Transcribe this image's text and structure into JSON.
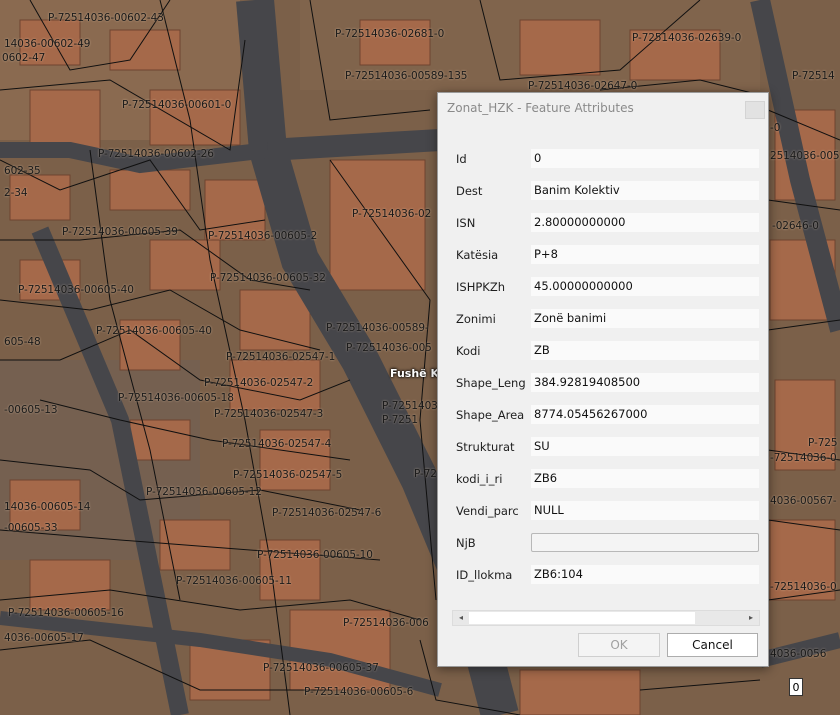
{
  "map": {
    "parcel_labels": [
      "P-72514036-00602-43",
      "14036-00602-49",
      "0602-47",
      "P-72514036-02681-0",
      "P-72514036-02639-0",
      "P-72514036-00589-135",
      "P-72514036-02647-0",
      "P-72514",
      "P-72514036-00601-0",
      "P-72514036-00602-26",
      "602-35",
      "2-34",
      "P-72514036-02",
      "P-72514036-00605-39",
      "P-72514036-00605-2",
      "P-72514036-00605-40",
      "P-72514036-00605-32",
      "P-72514036-00605-40",
      "605-48",
      "P-72514036-00589-",
      "P-72514036-02547-1",
      "P-72514036-005",
      "P-72514036-02547-2",
      "P-72514036-00605-18",
      "P-72514036-02547-3",
      "-00605-13",
      "P-7251403",
      "P-72514036-02547-4",
      "P-72514036-02547-5",
      "P-72514036-00605-12",
      "14036-00605-14",
      "-00605-33",
      "P-72514036-02547-6",
      "P-72514036-00605-10",
      "P-72514036-00605-11",
      "P-72514036-00605-16",
      "4036-00605-17",
      "P-72514036-006",
      "P-72514036-00605-37",
      "P-72514036-00605-6",
      "P-7251",
      "P-72",
      "2514036-005",
      "-02646-0",
      "P-725",
      "-72514036-0",
      "4036-00567-",
      "-72514036-0",
      "4036-0056",
      "-0"
    ],
    "place_label": "Fushë K",
    "corner_badge": "0"
  },
  "dialog": {
    "title": "Zonat_HZK - Feature Attributes",
    "fields": [
      {
        "label": "Id",
        "value": "0"
      },
      {
        "label": "Dest",
        "value": "Banim Kolektiv"
      },
      {
        "label": "ISN",
        "value": "2.80000000000"
      },
      {
        "label": "Katësia",
        "value": "P+8"
      },
      {
        "label": "ISHPKZh",
        "value": "45.00000000000"
      },
      {
        "label": "Zonimi",
        "value": "Zonë banimi"
      },
      {
        "label": "Kodi",
        "value": "ZB"
      },
      {
        "label": "Shape_Leng",
        "value": "384.92819408500"
      },
      {
        "label": "Shape_Area",
        "value": "8774.05456267000"
      },
      {
        "label": "Strukturat",
        "value": "SU"
      },
      {
        "label": "kodi_i_ri",
        "value": "ZB6"
      },
      {
        "label": "Vendi_parc",
        "value": "NULL"
      },
      {
        "label": "NjB",
        "value": ""
      },
      {
        "label": "ID_llokma",
        "value": "ZB6:104"
      }
    ],
    "ok_label": "OK",
    "cancel_label": "Cancel",
    "scroll_left": "◂",
    "scroll_right": "▸"
  },
  "colors": {
    "road": "#46464a",
    "roof": "#a5694a",
    "ground": "#7b6049",
    "parcel_line": "#101010"
  }
}
